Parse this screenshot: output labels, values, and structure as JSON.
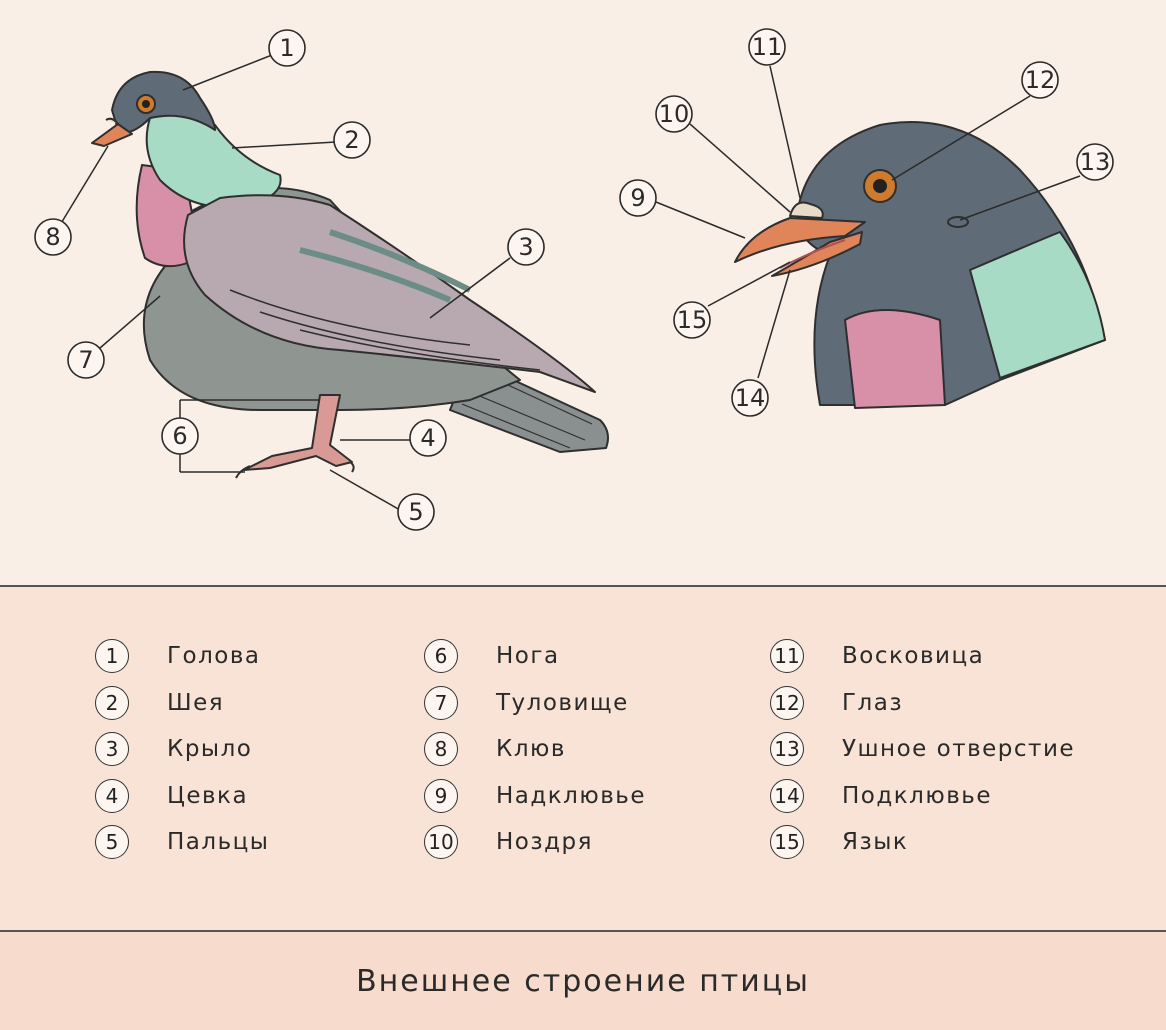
{
  "figure": {
    "callouts": [
      "1",
      "2",
      "3",
      "4",
      "5",
      "6",
      "7",
      "8",
      "9",
      "10",
      "11",
      "12",
      "13",
      "14",
      "15"
    ]
  },
  "legend": {
    "items": [
      {
        "num": "1",
        "label": "Голова"
      },
      {
        "num": "2",
        "label": "Шея"
      },
      {
        "num": "3",
        "label": "Крыло"
      },
      {
        "num": "4",
        "label": "Цевка"
      },
      {
        "num": "5",
        "label": "Пальцы"
      },
      {
        "num": "6",
        "label": "Нога"
      },
      {
        "num": "7",
        "label": "Туловище"
      },
      {
        "num": "8",
        "label": "Клюв"
      },
      {
        "num": "9",
        "label": "Надклювье"
      },
      {
        "num": "10",
        "label": "Ноздря"
      },
      {
        "num": "11",
        "label": "Восковица"
      },
      {
        "num": "12",
        "label": "Глаз"
      },
      {
        "num": "13",
        "label": "Ушное отверстие"
      },
      {
        "num": "14",
        "label": "Подклювье"
      },
      {
        "num": "15",
        "label": "Язык"
      }
    ]
  },
  "footer": {
    "title": "Внешнее строение птицы"
  },
  "colors": {
    "background": "#f9efe6",
    "legend_bg": "#f8e3d6",
    "footer_bg": "#f7dccd",
    "head_gray": "#5f6b76",
    "neck_green": "#a8dcc8",
    "breast_pink": "#d98fa8",
    "wing_mauve": "#b9aab0",
    "body_gray": "#8c918e",
    "beak_orange": "#e0855a",
    "leg_pink": "#d98f8f",
    "eye_orange": "#d07a2e",
    "cere": "#e8dcc8"
  }
}
